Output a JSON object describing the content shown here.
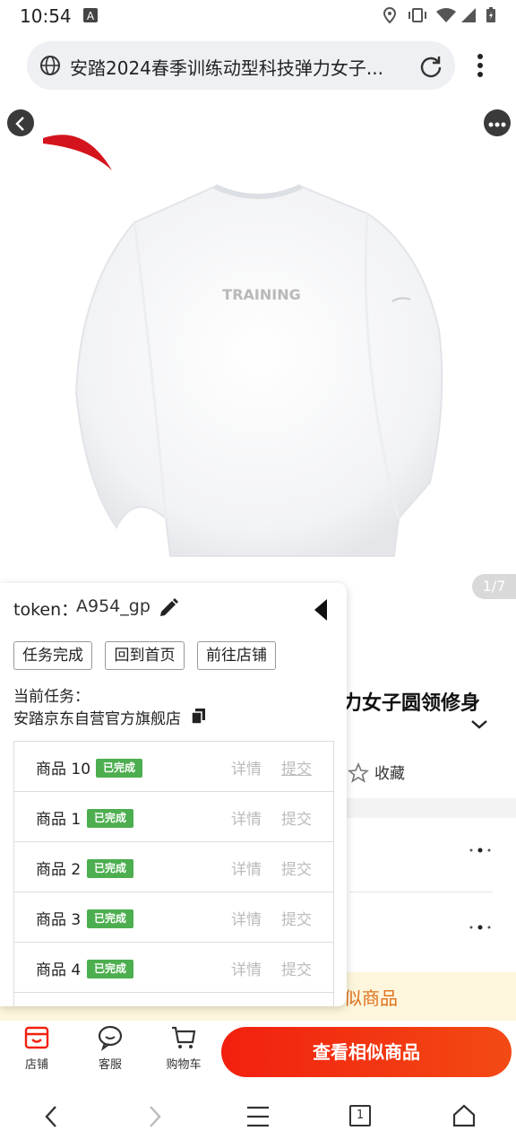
{
  "status_bar": {
    "time": "10:54"
  },
  "browser": {
    "url_text": "安踏2024春季训练动型科技弹力女子..."
  },
  "product": {
    "image_counter": "1/7",
    "title_visible": "力女子圆领修身",
    "collect_label": "收藏",
    "similar_banner": "似商品"
  },
  "bottom_bar": {
    "store_label": "店铺",
    "service_label": "客服",
    "cart_label": "购物车",
    "view_similar_label": "查看相似商品"
  },
  "nav": {
    "tab_count": "1"
  },
  "panel": {
    "token_label": "token：",
    "token_value": "A954_gp",
    "buttons": {
      "task_done": "任务完成",
      "back_home": "回到首页",
      "go_store": "前往店铺"
    },
    "current_task_label": "当前任务：",
    "store_name": "安踏京东自营官方旗舰店",
    "rows": [
      {
        "name": "商品 10",
        "status": "已完成",
        "detail": "详情",
        "submit": "提交"
      },
      {
        "name": "商品 1",
        "status": "已完成",
        "detail": "详情",
        "submit": "提交"
      },
      {
        "name": "商品 2",
        "status": "已完成",
        "detail": "详情",
        "submit": "提交"
      },
      {
        "name": "商品 3",
        "status": "已完成",
        "detail": "详情",
        "submit": "提交"
      },
      {
        "name": "商品 4",
        "status": "已完成",
        "detail": "详情",
        "submit": "提交"
      }
    ]
  },
  "colors": {
    "accent_red": "#f2200f",
    "badge_green": "#4cae4f",
    "banner_orange": "#e0711d"
  }
}
